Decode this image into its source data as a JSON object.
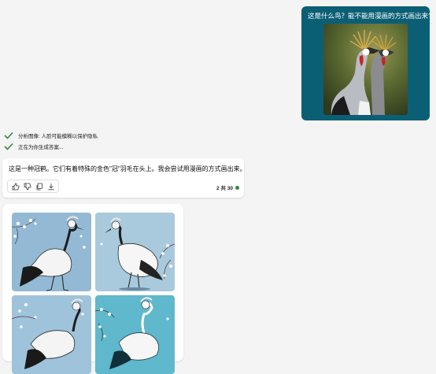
{
  "user_message": {
    "text": "这是什么鸟？能不能用漫画的方式画出来?"
  },
  "status": [
    {
      "label": "分析图像: 人脸可能模糊以保护隐私"
    },
    {
      "label": "正在为你生成答案..."
    }
  ],
  "reply": {
    "text": "这是一种冠鹤。它们有着特殊的金色\"冠\"羽毛在头上。我会尝试用漫画的方式画出来。",
    "page_indicator": "2 共 30",
    "actions": [
      "thumbs-up-icon",
      "thumbs-down-icon",
      "copy-icon",
      "download-icon"
    ]
  },
  "colors": {
    "user_bubble": "#0b5f75",
    "check": "#2e8b3a",
    "status_dot": "#2e8b3a"
  }
}
